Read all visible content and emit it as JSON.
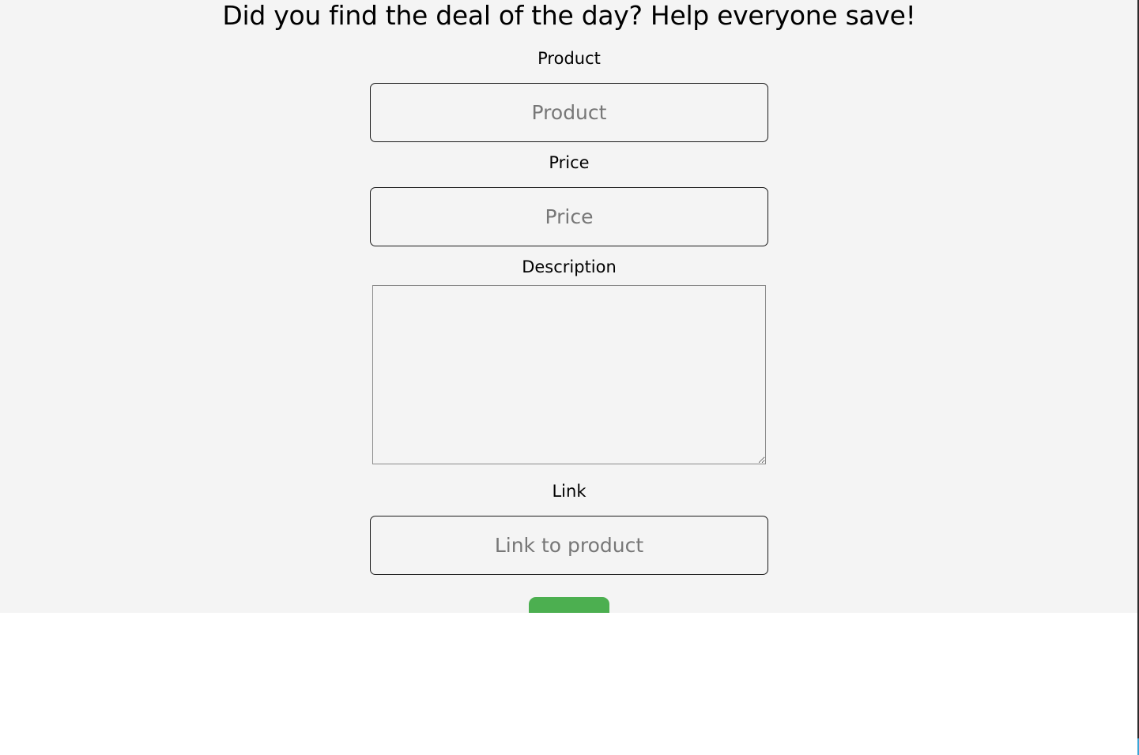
{
  "page": {
    "title": "Did you find the deal of the day? Help everyone save!"
  },
  "form": {
    "product": {
      "label": "Product",
      "placeholder": "Product",
      "value": ""
    },
    "price": {
      "label": "Price",
      "placeholder": "Price",
      "value": ""
    },
    "description": {
      "label": "Description",
      "value": ""
    },
    "link": {
      "label": "Link",
      "placeholder": "Link to product",
      "value": ""
    },
    "submit": {
      "color": "#4caf50"
    }
  },
  "colors": {
    "panel_background": "#f4f4f4",
    "page_background": "#ffffff",
    "accent": "#4caf50"
  }
}
